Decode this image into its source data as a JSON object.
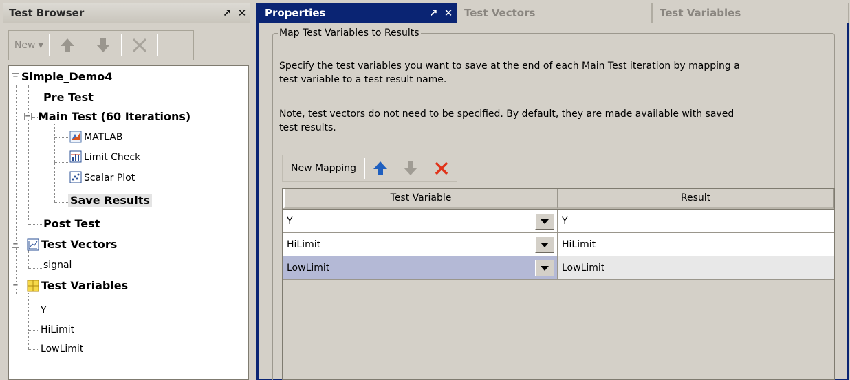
{
  "left_panel": {
    "title": "Test Browser",
    "toolbar": {
      "new_label": "New"
    },
    "tree": {
      "root": "Simple_Demo4",
      "pre_test": "Pre Test",
      "main_test": "Main Test (60 Iterations)",
      "steps": [
        "MATLAB",
        "Limit Check",
        "Scalar Plot",
        "Save Results"
      ],
      "post_test": "Post Test",
      "test_vectors": "Test Vectors",
      "vectors": [
        "signal"
      ],
      "test_variables": "Test Variables",
      "variables": [
        "Y",
        "HiLimit",
        "LowLimit"
      ]
    }
  },
  "right_panel": {
    "tabs": [
      "Properties",
      "Test Vectors",
      "Test Variables"
    ],
    "group_title": "Map Test Variables to Results",
    "desc1_line1": "Specify the test variables you want to save at the end of each Main Test iteration by mapping a",
    "desc1_line2": "test variable to a test result name.",
    "desc2_line1": "Note, test vectors do not need to be specified. By default, they are made available with saved",
    "desc2_line2": "test results.",
    "new_mapping_label": "New Mapping",
    "columns": [
      "Test Variable",
      "Result"
    ],
    "rows": [
      {
        "variable": "Y",
        "result": "Y"
      },
      {
        "variable": "HiLimit",
        "result": "HiLimit"
      },
      {
        "variable": "LowLimit",
        "result": "LowLimit"
      }
    ]
  },
  "colors": {
    "active_tab": "#0a2473",
    "selected_row": "#b4b9d6",
    "delete": "#e0331a",
    "arrow_up": "#1f5fbf"
  }
}
